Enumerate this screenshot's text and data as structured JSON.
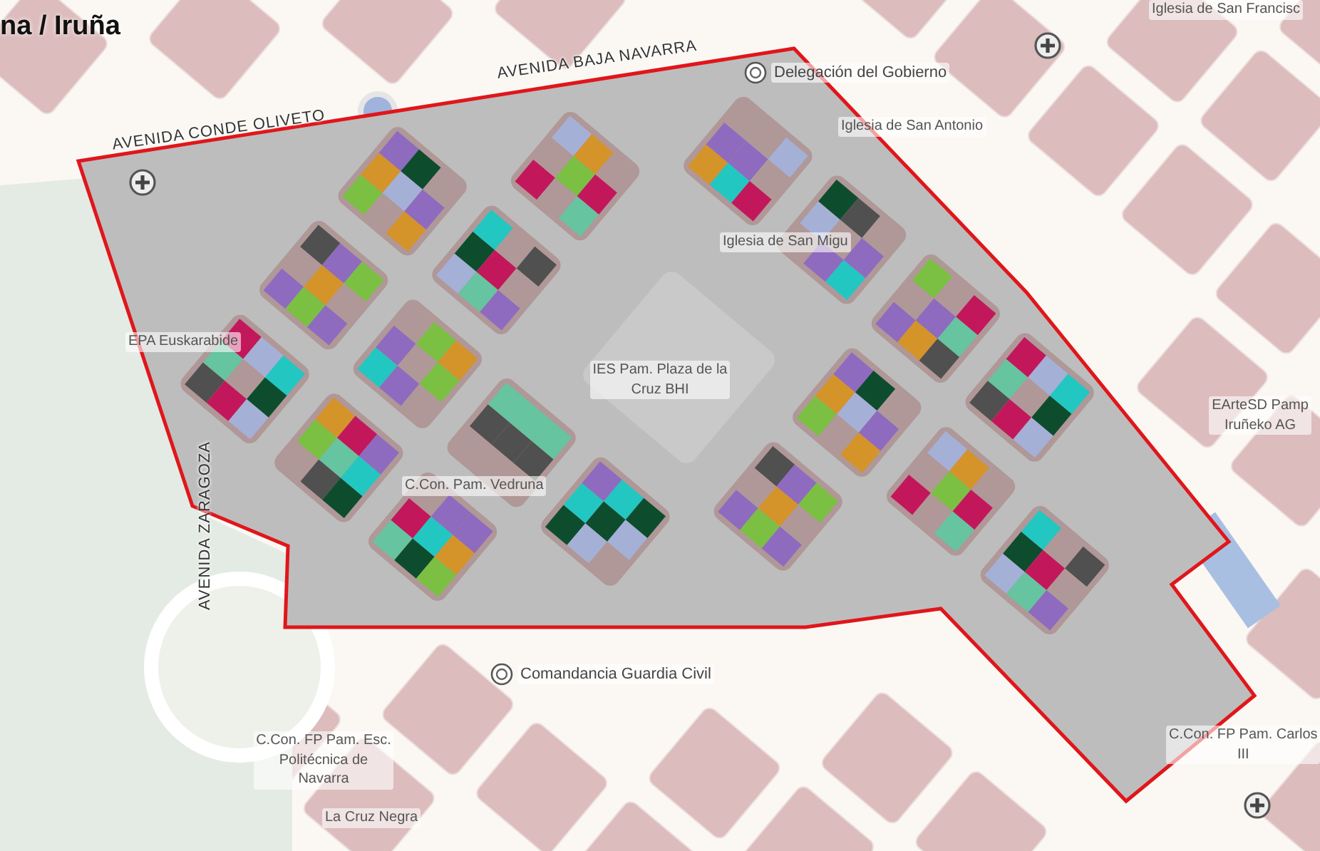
{
  "map": {
    "city_label": "na / Iruña",
    "streets": [
      {
        "name": "AVENIDA BAJA NAVARRA"
      },
      {
        "name": "AVENIDA CONDE OLIVETO"
      },
      {
        "name": "AVENIDA ZARAGOZA"
      }
    ],
    "places": [
      {
        "kind": "emblem",
        "lines": [
          "Delegación del Gobierno"
        ]
      },
      {
        "kind": "label",
        "lines": [
          "Iglesia de San Antonio"
        ]
      },
      {
        "kind": "label",
        "lines": [
          "Iglesia de San Francisc"
        ]
      },
      {
        "kind": "label",
        "lines": [
          "Iglesia de San Migu"
        ]
      },
      {
        "kind": "label",
        "lines": [
          "EPA Euskarabide"
        ]
      },
      {
        "kind": "label",
        "lines": [
          "IES Pam. Plaza de la",
          "Cruz BHI"
        ]
      },
      {
        "kind": "label",
        "lines": [
          "C.Con. Pam. Vedruna"
        ]
      },
      {
        "kind": "label",
        "lines": [
          "EArteSD Pamp",
          "Iruñeko AG"
        ]
      },
      {
        "kind": "emblem",
        "lines": [
          "Comandancia Guardia Civil"
        ]
      },
      {
        "kind": "label",
        "lines": [
          "C.Con. FP Pam. Esc.",
          "Politécnica de",
          "Navarra"
        ]
      },
      {
        "kind": "label",
        "lines": [
          "La Cruz Negra"
        ]
      },
      {
        "kind": "label",
        "lines": [
          "C.Con. FP Pam. Carlos",
          "III"
        ]
      }
    ]
  }
}
